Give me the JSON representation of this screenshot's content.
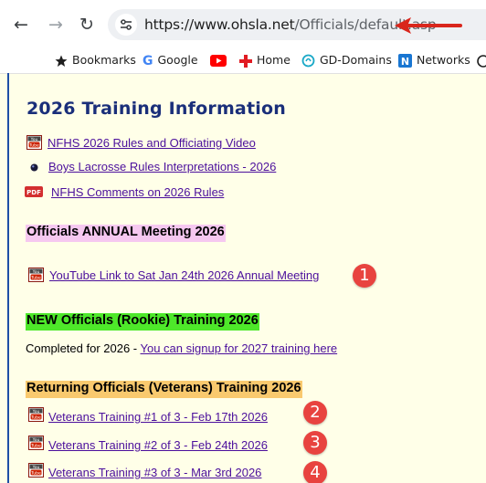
{
  "browser": {
    "url_domain": "https://www.ohsla.net",
    "url_path": "/Officials/default.asp",
    "bookmarks": [
      {
        "label": "Bookmarks",
        "icon": "star-icon"
      },
      {
        "label": "Google",
        "icon": "google-icon"
      },
      {
        "label": "",
        "icon": "youtube-icon"
      },
      {
        "label": "Home",
        "icon": "red-cross-icon"
      },
      {
        "label": "GD-Domains",
        "icon": "gd-icon"
      },
      {
        "label": "Networks",
        "icon": "n-icon"
      }
    ]
  },
  "page": {
    "title": "2026 Training Information",
    "training_links": [
      {
        "text": "NFHS 2026 Rules and Officiating Video",
        "icon": "youtube-icon"
      },
      {
        "text": "Boys Lacrosse Rules Interpretations - 2026",
        "icon": "bullet-icon"
      },
      {
        "text": "NFHS Comments on 2026 Rules",
        "icon": "pdf-icon"
      }
    ],
    "annual_meeting": {
      "heading": "Officials ANNUAL Meeting 2026",
      "link": "YouTube Link to Sat Jan 24th 2026 Annual Meeting",
      "badge": "1"
    },
    "rookie": {
      "heading": "NEW Officials (Rookie) Training 2026",
      "prefix": "Completed for 2026 - ",
      "link": "You can signup for 2027 training here"
    },
    "veterans": {
      "heading": "Returning Officials (Veterans) Training 2026",
      "links": [
        {
          "text": "Veterans Training #1 of 3  -  Feb 17th 2026",
          "badge": "2"
        },
        {
          "text": "Veterans Training #2 of 3  -  Feb 24th 2026",
          "badge": "3"
        },
        {
          "text": "Veterans Training #3 of 3  -  Mar 3rd 2026",
          "badge": "4"
        }
      ]
    }
  },
  "colors": {
    "page_bg": "#ffffe8",
    "title": "#1a2f7a",
    "link": "#4b0f9c",
    "pink_highlight": "#f6c8f0",
    "green_highlight": "#4ee82a",
    "orange_highlight": "#f9c96e",
    "badge": "#e8433f",
    "arrow": "#d9261c"
  }
}
